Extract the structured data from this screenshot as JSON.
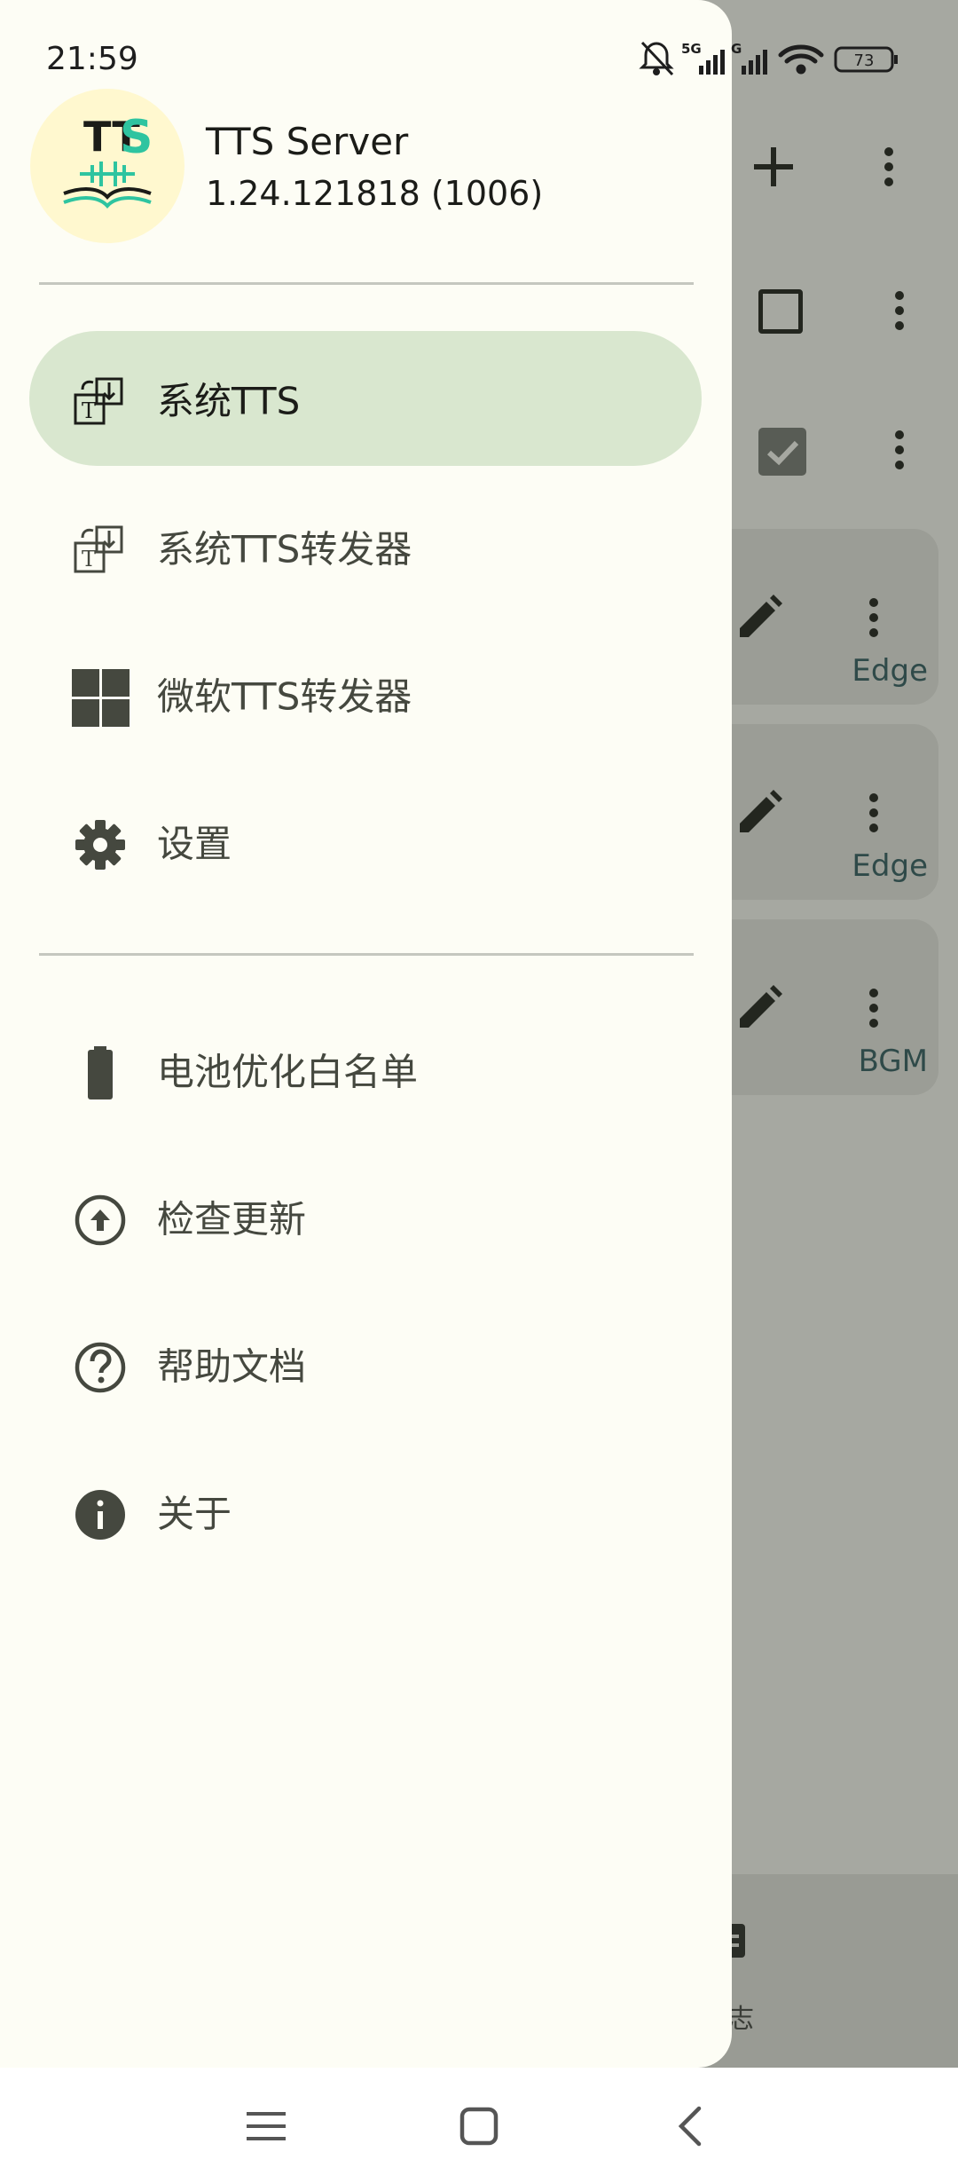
{
  "status_bar": {
    "time": "21:59",
    "network_label": "5G",
    "network_label_2": "G",
    "battery": "73"
  },
  "drawer": {
    "app_name": "TTS Server",
    "app_version": "1.24.121818 (1006)",
    "logo_text": "TTS",
    "primary_items": [
      {
        "label": "系统TTS",
        "icon": "system-tts-icon",
        "active": true
      },
      {
        "label": "系统TTS转发器",
        "icon": "system-tts-forwarder-icon",
        "active": false
      },
      {
        "label": "微软TTS转发器",
        "icon": "windows-icon",
        "active": false
      },
      {
        "label": "设置",
        "icon": "gear-icon",
        "active": false
      }
    ],
    "secondary_items": [
      {
        "label": "电池优化白名单",
        "icon": "battery-icon"
      },
      {
        "label": "检查更新",
        "icon": "upload-circle-icon"
      },
      {
        "label": "帮助文档",
        "icon": "help-circle-icon"
      },
      {
        "label": "关于",
        "icon": "info-icon"
      }
    ]
  },
  "background": {
    "cards": [
      {
        "tag": "Edge"
      },
      {
        "tag": "Edge"
      },
      {
        "tag": "BGM"
      }
    ],
    "bottom_nav_label": "志"
  },
  "colors": {
    "drawer_bg": "#fdfdf5",
    "active_item_bg": "#d9e7cf",
    "scrim": "#a6a8a1",
    "icon": "#45483f",
    "logo_accent": "#2ec4a0"
  }
}
